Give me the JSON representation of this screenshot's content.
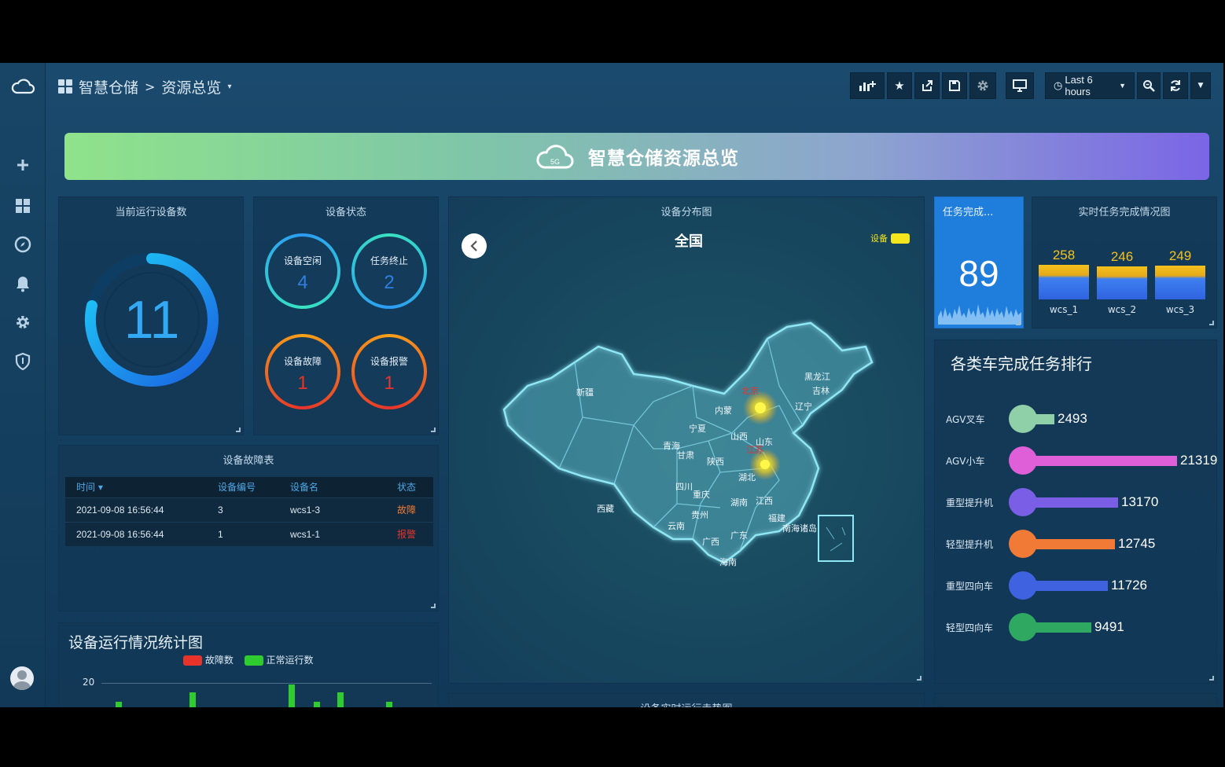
{
  "header": {
    "breadcrumb_root": "智慧仓储",
    "breadcrumb_sep": ">",
    "breadcrumb_page": "资源总览",
    "breadcrumb_caret": "▾",
    "time_range": "Last 6 hours"
  },
  "icons": {
    "sidebar": [
      "cloud-logo-icon",
      "plus-icon",
      "dashboards-icon",
      "compass-icon",
      "bell-icon",
      "gear-icon",
      "shield-icon"
    ],
    "toolbar": [
      "add-panel-icon",
      "star-icon",
      "share-icon",
      "save-icon",
      "settings-icon",
      "tv-mode-icon",
      "clock-icon",
      "zoom-out-icon",
      "refresh-icon",
      "caret-down-icon"
    ]
  },
  "banner": {
    "title": "智慧仓储资源总览",
    "icon": "cloud-5g-icon",
    "icon_text": "5G"
  },
  "running": {
    "title": "当前运行设备数",
    "value": "11"
  },
  "status": {
    "title": "设备状态",
    "items": [
      {
        "label": "设备空闲",
        "value": "4",
        "color": "#2f7fe0"
      },
      {
        "label": "任务终止",
        "value": "2",
        "color": "#2f7fe0"
      },
      {
        "label": "设备故障",
        "value": "1",
        "color": "#e8332a"
      },
      {
        "label": "设备报警",
        "value": "1",
        "color": "#e8332a"
      }
    ]
  },
  "faults": {
    "title": "设备故障表",
    "columns": [
      "时间 ▾",
      "设备编号",
      "设备名",
      "状态"
    ],
    "rows": [
      [
        "2021-09-08 16:56:44",
        "3",
        "wcs1-3",
        "故障"
      ],
      [
        "2021-09-08 16:56:44",
        "1",
        "wcs1-1",
        "报警"
      ]
    ]
  },
  "map": {
    "title": "设备分布图",
    "region": "全国",
    "legend": "设备",
    "back_icon": "chevron-left-icon",
    "provinces": [
      "新疆",
      "西藏",
      "内蒙",
      "黑龙江",
      "吉林",
      "辽宁",
      "宁夏",
      "青海",
      "甘肃",
      "陕西",
      "山西",
      "山东",
      "四川",
      "重庆",
      "湖北",
      "湖南",
      "江西",
      "贵州",
      "云南",
      "广西",
      "广东",
      "福建",
      "海南",
      "南海诸岛"
    ],
    "hotspots": [
      "北京",
      "江苏"
    ]
  },
  "task_done": {
    "title": "任务完成...",
    "value": "89"
  },
  "realtime": {
    "title": "实时任务完成情况图",
    "bars": [
      {
        "name": "wcs_1",
        "value": "258"
      },
      {
        "name": "wcs_2",
        "value": "246"
      },
      {
        "name": "wcs_3",
        "value": "249"
      }
    ]
  },
  "ranking": {
    "title": "各类车完成任务排行",
    "items": [
      {
        "label": "AGV叉车",
        "value": 2493,
        "color": "#8fd0a8",
        "bar": "#8fd0a8"
      },
      {
        "label": "AGV小车",
        "value": 21319,
        "color": "#df5fd8",
        "bar": "#df5fd8"
      },
      {
        "label": "重型提升机",
        "value": 13170,
        "color": "#7a5fe6",
        "bar": "#7a5fe6"
      },
      {
        "label": "轻型提升机",
        "value": 12745,
        "color": "#f07a36",
        "bar": "#f07a36"
      },
      {
        "label": "重型四向车",
        "value": 11726,
        "color": "#3f62e0",
        "bar": "#3f62e0"
      },
      {
        "label": "轻型四向车",
        "value": 9491,
        "color": "#2fa862",
        "bar": "#2fa862"
      }
    ]
  },
  "stats": {
    "title": "设备运行情况统计图",
    "legend_fault": "故障数",
    "legend_normal": "正常运行数",
    "fault_color": "#e8332a",
    "normal_color": "#2ecc2e",
    "y_tick": "20"
  },
  "trend": {
    "title": "设备实时运行走势图"
  }
}
